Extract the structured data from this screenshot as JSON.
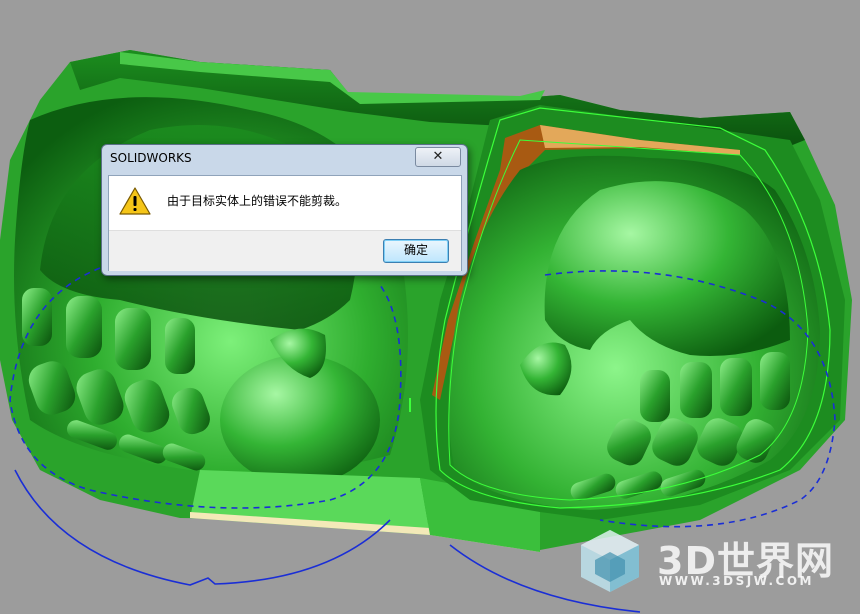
{
  "dialog": {
    "title": "SOLIDWORKS",
    "close_label": "✕",
    "icon": "warning-icon",
    "message": "由于目标实体上的错误不能剪裁。",
    "ok_label": "确定"
  },
  "watermark": {
    "logo": "3D世界网",
    "url": "WWW.3DSJW.COM"
  },
  "colors": {
    "background": "#9c9c9c",
    "model_green": "#2fae2f",
    "model_dark_green": "#0f6e12",
    "section_orange": "#a85a12",
    "sketch_blue": "#1a2ed6"
  }
}
